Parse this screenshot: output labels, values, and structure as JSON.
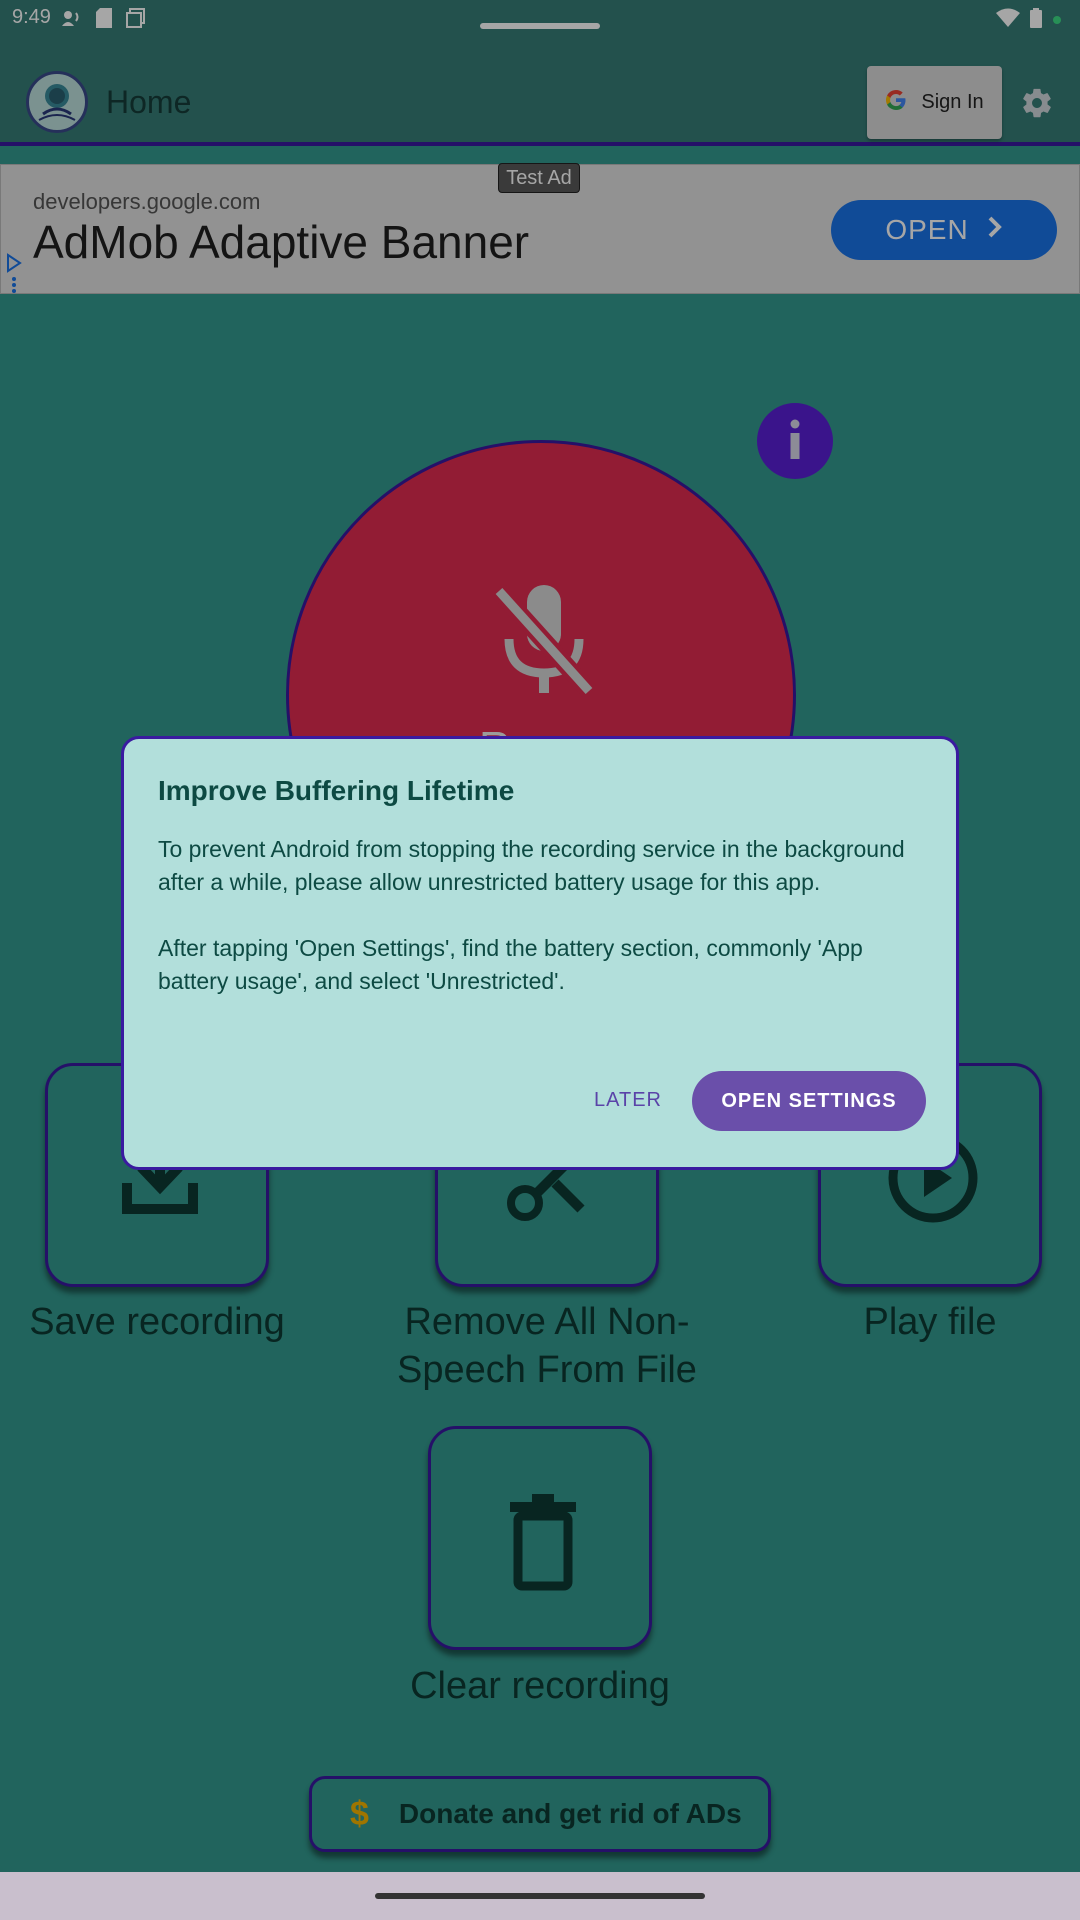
{
  "status_bar": {
    "time": "9:49",
    "icons": [
      "audio-icon",
      "sd-card-icon",
      "screenshot-icon",
      "wifi-icon",
      "battery-icon",
      "dot-icon"
    ]
  },
  "app_bar": {
    "title": "Home",
    "sign_in_label": "Sign In",
    "settings_icon": "gear-icon"
  },
  "ad": {
    "badge": "Test Ad",
    "domain": "developers.google.com",
    "headline": "AdMob Adaptive Banner",
    "open_label": "OPEN"
  },
  "main": {
    "record_button_label": "R",
    "actions": [
      {
        "label": "Save recording",
        "icon": "save-icon"
      },
      {
        "label": "Remove All Non-Speech From File",
        "icon": "scissors-icon"
      },
      {
        "label": "Play file",
        "icon": "play-icon"
      },
      {
        "label": "Clear recording",
        "icon": "trash-icon"
      }
    ],
    "donate_symbol": "$",
    "donate_label": "Donate and get rid of ADs"
  },
  "dialog": {
    "title": "Improve Buffering Lifetime",
    "paragraph1": "To prevent Android from stopping the recording service in the background after a while, please allow unrestricted battery usage for this app.",
    "paragraph2": "After tapping 'Open Settings', find the battery section, commonly 'App battery usage', and select 'Unrestricted'.",
    "later_label": "LATER",
    "open_settings_label": "OPEN SETTINGS"
  },
  "colors": {
    "app_bar": "#367d77",
    "accent_border": "#3a1aa0",
    "record_button": "#e02b50",
    "dialog_bg": "#b2dfdb",
    "primary_button": "#6a4faa",
    "ad_button": "#1a73e8"
  }
}
